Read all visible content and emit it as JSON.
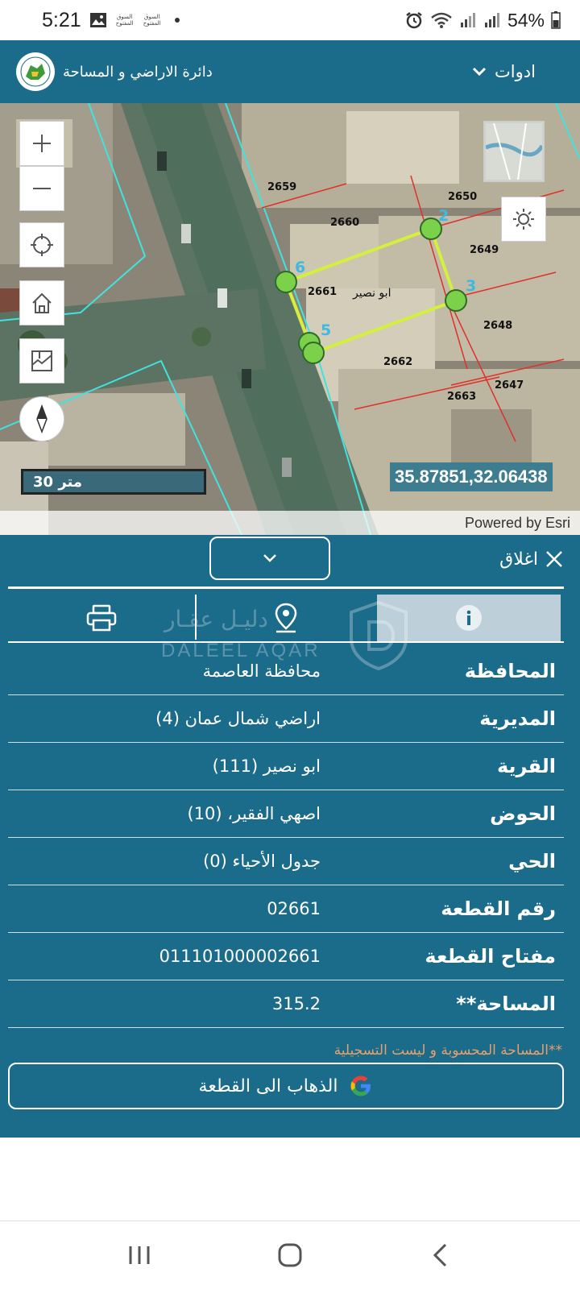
{
  "status_bar": {
    "time": "5:21",
    "mini_logo_1": "السوق المفتوح",
    "mini_logo_2": "السوق المفتوح",
    "battery": "54%",
    "icons": [
      "gallery-icon",
      "alarm-icon",
      "wifi-icon",
      "signal-icon",
      "battery-icon"
    ]
  },
  "header": {
    "title": "دائرة الاراضي و المساحة",
    "tools_label": "ادوات",
    "background_color": "#1b6b8a"
  },
  "map": {
    "parcel_numbers": [
      "2659",
      "2660",
      "2650",
      "2649",
      "2661",
      "2648",
      "2662",
      "2647",
      "2663"
    ],
    "village_label": "ابو نصير",
    "vertex_labels": [
      "2",
      "3",
      "5",
      "6"
    ],
    "scale_label": "30 متر",
    "coordinates": "35.87851,32.06438",
    "attribution": "Powered by Esri",
    "parcel_outline_color": "#d4f03c",
    "vertex_color": "#7bd14a",
    "road_boundary_color": "#3fe3e0"
  },
  "panel": {
    "close_label": "اغلاق",
    "tabs": [
      "info",
      "location",
      "print"
    ],
    "watermark_ar": "دليـل عقـار",
    "watermark_en": "DALEEL AQAR",
    "rows": [
      {
        "label": "المحافظة",
        "value": "محافظة العاصمة"
      },
      {
        "label": "المديرية",
        "value": "اراضي شمال عمان (4)"
      },
      {
        "label": "القرية",
        "value": "ابو نصير (111)"
      },
      {
        "label": "الحوض",
        "value": "اصهي الفقير، (10)"
      },
      {
        "label": "الحي",
        "value": "جدول الأحياء (0)"
      },
      {
        "label": "رقم القطعة",
        "value": "02661"
      },
      {
        "label": "مفتاح القطعة",
        "value": "011101000002661"
      },
      {
        "label": "المساحة**",
        "value": "315.2"
      }
    ],
    "footnote": "**المساحة المحسوبة و ليست التسجيلية",
    "goto_label": "الذهاب الى القطعة",
    "footnote_color": "#e8a06a"
  }
}
